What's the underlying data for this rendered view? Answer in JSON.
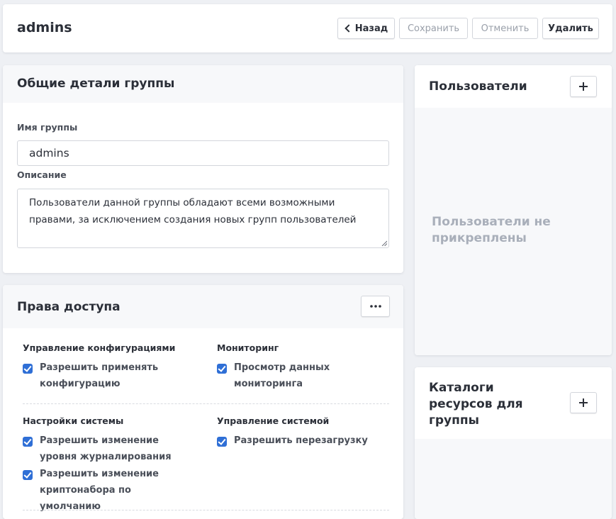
{
  "header": {
    "title": "admins",
    "back_label": "Назад",
    "save_label": "Сохранить",
    "cancel_label": "Отменить",
    "delete_label": "Удалить"
  },
  "details": {
    "title": "Общие детали группы",
    "name_label": "Имя группы",
    "name_value": "admins",
    "description_label": "Описание",
    "description_value": "Пользователи данной группы обладают всеми  возможными правами, за исключением создания новых групп пользователей"
  },
  "permissions": {
    "title": "Права доступа",
    "groups": [
      {
        "title": "Управление конфигурациями",
        "items": [
          "Разрешить применять конфигурацию"
        ]
      },
      {
        "title": "Мониторинг",
        "items": [
          "Просмотр данных мониторинга"
        ]
      },
      {
        "title": "Настройки системы",
        "items": [
          "Разрешить изменение уровня журналирования",
          "Разрешить изменение криптонабора по умолчанию"
        ]
      },
      {
        "title": "Управление системой",
        "items": [
          "Разрешить перезагрузку"
        ]
      }
    ]
  },
  "users": {
    "title": "Пользователи",
    "empty_text": "Пользователи не прикреплены"
  },
  "catalogs": {
    "title": "Каталоги ресурсов для группы"
  },
  "colors": {
    "accent": "#2f6fd6",
    "page_bg": "#eef0f4",
    "header_bg": "#f7f8fa",
    "muted_text": "#9aa0aa"
  }
}
